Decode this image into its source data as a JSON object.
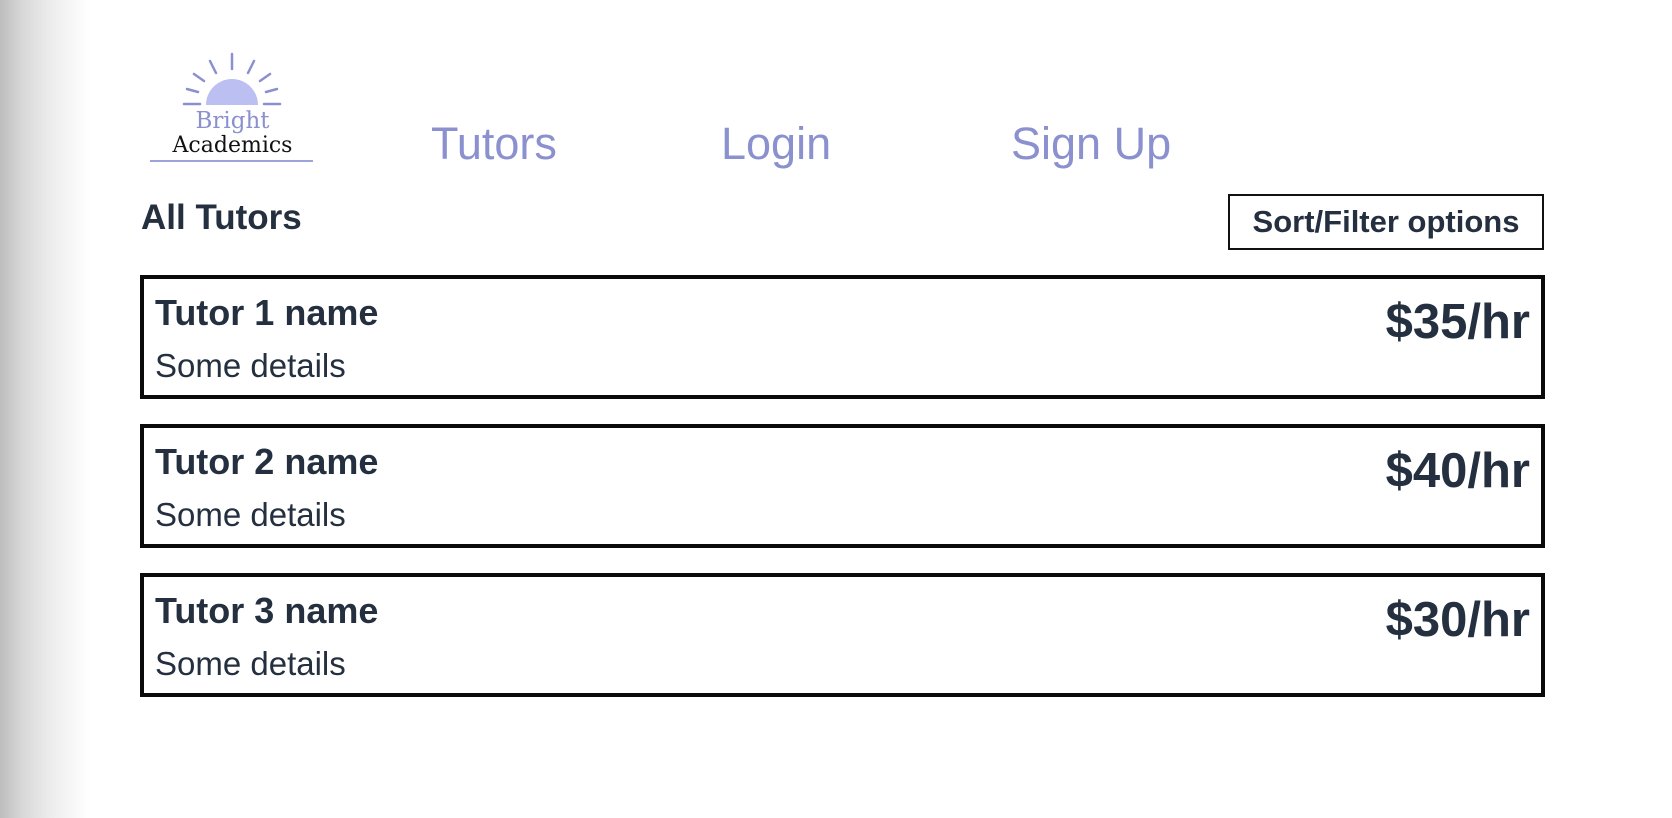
{
  "brand": {
    "logo_line_1": "Bright",
    "logo_line_2": "Academics",
    "logo_icon": "rising-sun-icon",
    "accent_color": "#8b90cf",
    "sun_color": "#bcbff2"
  },
  "nav": {
    "tutors_label": "Tutors",
    "login_label": "Login",
    "signup_label": "Sign Up"
  },
  "main": {
    "title": "All Tutors",
    "sort_filter_label": "Sort/Filter options",
    "tutors": [
      {
        "name": "Tutor 1 name",
        "details": "Some details",
        "rate": "$35/hr"
      },
      {
        "name": "Tutor 2 name",
        "details": "Some details",
        "rate": "$40/hr"
      },
      {
        "name": "Tutor 3 name",
        "details": "Some details",
        "rate": "$30/hr"
      }
    ]
  }
}
